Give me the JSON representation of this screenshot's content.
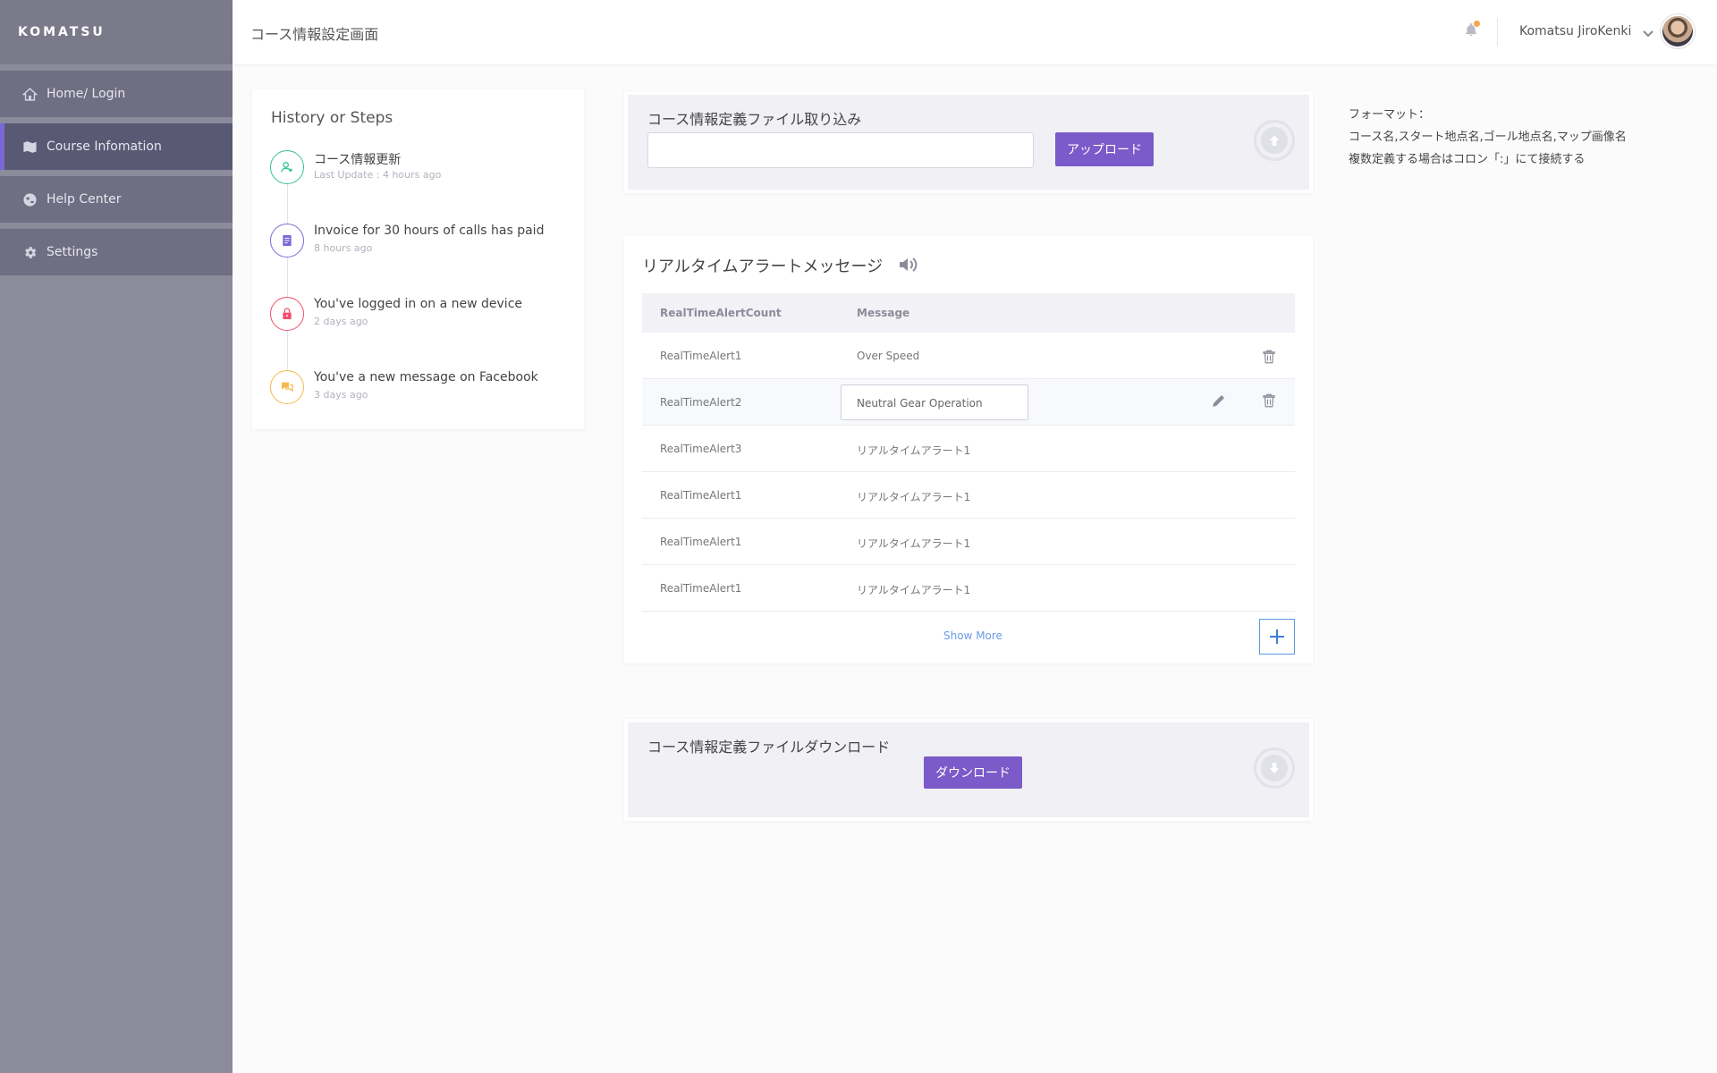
{
  "sidebar": {
    "brand": "KOMATSU",
    "items": [
      {
        "label": "Home/ Login",
        "icon": "home-icon"
      },
      {
        "label": "Course Infomation",
        "icon": "map-icon",
        "active": true
      },
      {
        "label": "Help Center",
        "icon": "globe-icon"
      },
      {
        "label": "Settings",
        "icon": "gear-icon"
      }
    ]
  },
  "header": {
    "title": "コース情報設定画面",
    "user_name": "Komatsu JiroKenki",
    "notification_dot_color": "#f7a64a"
  },
  "history": {
    "title": "History or Steps",
    "items": [
      {
        "title": "コース情報更新",
        "time": "Last Update : 4 hours ago",
        "icon": "user-plus-icon",
        "color": "#34c38f"
      },
      {
        "title": "Invoice for 30 hours of calls has paid",
        "time": "8 hours ago",
        "icon": "document-icon",
        "color": "#7b68d6"
      },
      {
        "title": "You've logged in on a new device",
        "time": "2 days ago",
        "icon": "lock-icon",
        "color": "#f0506e"
      },
      {
        "title": "You've a new message on Facebook",
        "time": "3 days ago",
        "icon": "chat-icon",
        "color": "#f7b84b"
      }
    ]
  },
  "upload": {
    "title": "コース情報定義ファイル取り込み",
    "input_value": "",
    "button_label": "アップロード"
  },
  "format_note": {
    "label": "フォーマット：",
    "line1": "コース名,スタート地点名,ゴール地点名,マップ画像名",
    "line2": "複数定義する場合はコロン「:」にて接続する"
  },
  "alerts": {
    "title": "リアルタイムアラートメッセージ",
    "columns": [
      "RealTimeAlertCount",
      "Message"
    ],
    "rows": [
      {
        "count": "RealTimeAlert1",
        "message": "Over Speed"
      },
      {
        "count": "RealTimeAlert2",
        "message": "Neutral Gear Operation",
        "editing": true
      },
      {
        "count": "RealTimeAlert3",
        "message": "リアルタイムアラート1"
      },
      {
        "count": "RealTimeAlert1",
        "message": "リアルタイムアラート1"
      },
      {
        "count": "RealTimeAlert1",
        "message": "リアルタイムアラート1"
      },
      {
        "count": "RealTimeAlert1",
        "message": "リアルタイムアラート1"
      }
    ],
    "show_more": "Show More"
  },
  "download": {
    "title": "コース情報定義ファイルダウンロード",
    "button_label": "ダウンロード"
  },
  "colors": {
    "accent": "#7b5ac9",
    "sidebar": "#8c8b9c",
    "link": "#6a9be6"
  }
}
